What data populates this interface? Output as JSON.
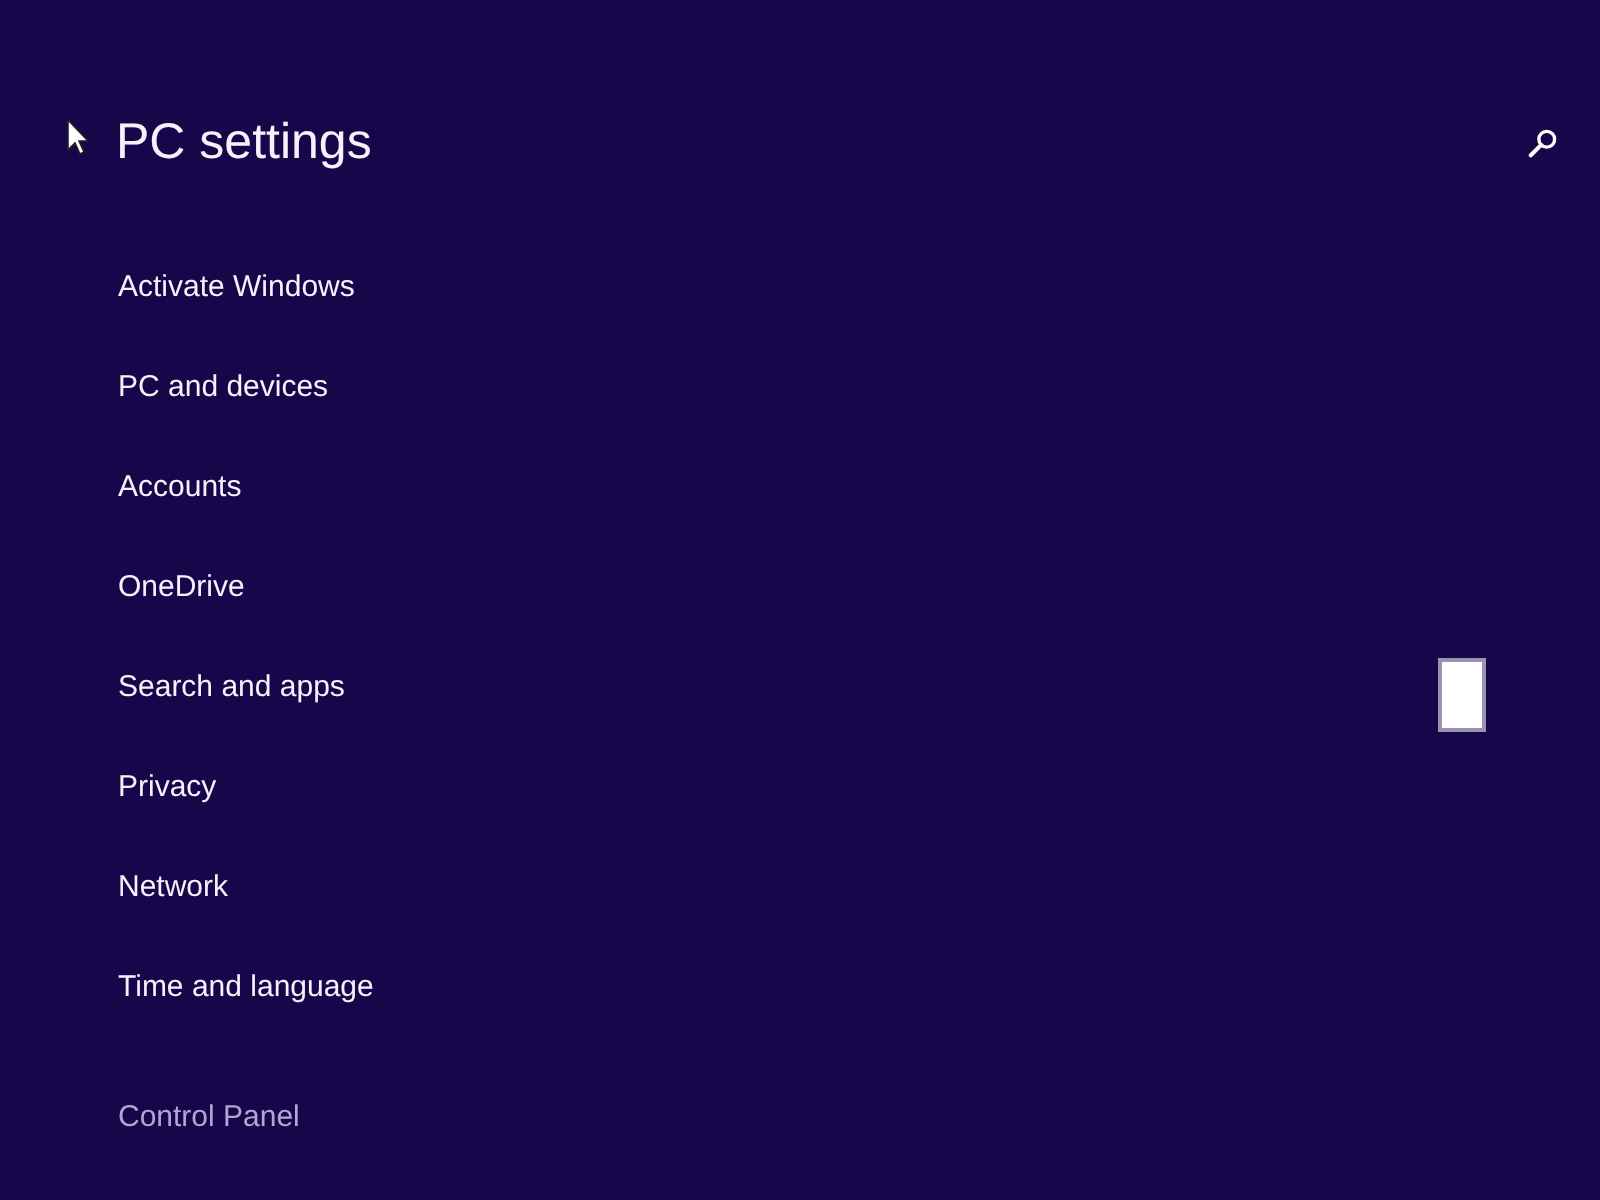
{
  "header": {
    "title": "PC settings"
  },
  "nav_items": [
    {
      "label": "Activate Windows",
      "kind": "category"
    },
    {
      "label": "PC and devices",
      "kind": "category"
    },
    {
      "label": "Accounts",
      "kind": "category"
    },
    {
      "label": "OneDrive",
      "kind": "category"
    },
    {
      "label": "Search and apps",
      "kind": "category"
    },
    {
      "label": "Privacy",
      "kind": "category"
    },
    {
      "label": "Network",
      "kind": "category"
    },
    {
      "label": "Time and language",
      "kind": "category"
    },
    {
      "label": "Control Panel",
      "kind": "link"
    }
  ]
}
